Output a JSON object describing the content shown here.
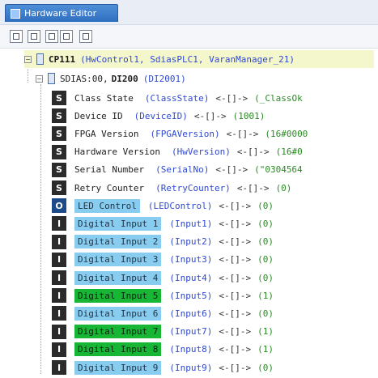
{
  "tab": {
    "title": "Hardware Editor"
  },
  "toolbar": {
    "buttons": [
      "import-icon",
      "grid-icon",
      "upload-icon",
      "copy-icon",
      "paste-icon"
    ]
  },
  "tree": {
    "root": {
      "name": "CP111",
      "detail": "(HwControl1, SdiasPLC1, VaranManager_21)"
    },
    "module": {
      "prefix": "SDIAS:00,",
      "name": "DI200",
      "detail": "(DI2001)"
    },
    "status_rows": [
      {
        "label": "Class State",
        "var": "(ClassState)",
        "arrow": "<-[]->",
        "value": "(_ClassOk"
      },
      {
        "label": "Device ID",
        "var": "(DeviceID)",
        "arrow": "<-[]->",
        "value": "(1001)"
      },
      {
        "label": "FPGA Version",
        "var": "(FPGAVersion)",
        "arrow": "<-[]->",
        "value": "(16#0000"
      },
      {
        "label": "Hardware Version",
        "var": "(HwVersion)",
        "arrow": "<-[]->",
        "value": "(16#0"
      },
      {
        "label": "Serial Number",
        "var": "(SerialNo)",
        "arrow": "<-[]->",
        "value": "(\"0304564"
      },
      {
        "label": "Retry Counter",
        "var": "(RetryCounter)",
        "arrow": "<-[]->",
        "value": "(0)"
      }
    ],
    "output_row": {
      "label": "LED Control",
      "var": "(LEDControl)",
      "arrow": "<-[]->",
      "value": "(0)"
    },
    "inputs": [
      {
        "label": "Digital Input 1",
        "var": "(Input1)",
        "arrow": "<-[]->",
        "value": "(0)",
        "state": "off"
      },
      {
        "label": "Digital Input 2",
        "var": "(Input2)",
        "arrow": "<-[]->",
        "value": "(0)",
        "state": "off"
      },
      {
        "label": "Digital Input 3",
        "var": "(Input3)",
        "arrow": "<-[]->",
        "value": "(0)",
        "state": "off"
      },
      {
        "label": "Digital Input 4",
        "var": "(Input4)",
        "arrow": "<-[]->",
        "value": "(0)",
        "state": "off"
      },
      {
        "label": "Digital Input 5",
        "var": "(Input5)",
        "arrow": "<-[]->",
        "value": "(1)",
        "state": "on"
      },
      {
        "label": "Digital Input 6",
        "var": "(Input6)",
        "arrow": "<-[]->",
        "value": "(0)",
        "state": "off"
      },
      {
        "label": "Digital Input 7",
        "var": "(Input7)",
        "arrow": "<-[]->",
        "value": "(1)",
        "state": "on"
      },
      {
        "label": "Digital Input 8",
        "var": "(Input8)",
        "arrow": "<-[]->",
        "value": "(1)",
        "state": "on"
      },
      {
        "label": "Digital Input 9",
        "var": "(Input9)",
        "arrow": "<-[]->",
        "value": "(0)",
        "state": "off"
      }
    ],
    "badges": {
      "status": "S",
      "output": "O",
      "input": "I"
    }
  }
}
